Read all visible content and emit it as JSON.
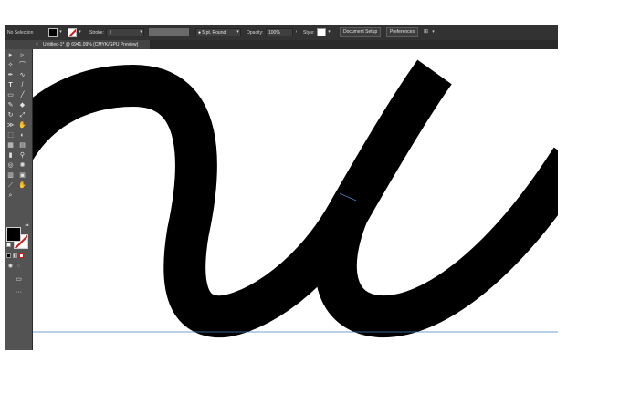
{
  "control_bar": {
    "selection_label": "No Selection",
    "stroke_label": "Stroke:",
    "brush_value": "5 pt. Round",
    "opacity_label": "Opacity:",
    "opacity_value": "100%",
    "style_label": "Style:",
    "document_setup_label": "Document Setup",
    "preferences_label": "Preferences"
  },
  "tab": {
    "close_glyph": "×",
    "title": "Untitled-1* @ 6941.09% (CMYK/GPU Preview)"
  },
  "colors": {
    "chrome_dark": "#323232",
    "panel_gray": "#535353",
    "stroke_black": "#000000",
    "guide_blue": "#4a7fc1",
    "none_red": "#dd1111"
  },
  "tools": [
    "selection-icon",
    "direct-selection-icon",
    "magic-wand-icon",
    "lasso-icon",
    "pen-icon",
    "curvature-icon",
    "type-icon",
    "line-icon",
    "rectangle-icon",
    "paintbrush-icon",
    "pencil-icon",
    "eraser-icon",
    "rotate-icon",
    "scale-icon",
    "width-icon",
    "warp-icon",
    "free-transform-icon",
    "shape-builder-icon",
    "perspective-icon",
    "mesh-icon",
    "gradient-icon",
    "eyedropper-icon",
    "blend-icon",
    "symbol-sprayer-icon",
    "column-graph-icon",
    "artboard-icon",
    "slice-icon",
    "hand-icon",
    "zoom-icon"
  ]
}
